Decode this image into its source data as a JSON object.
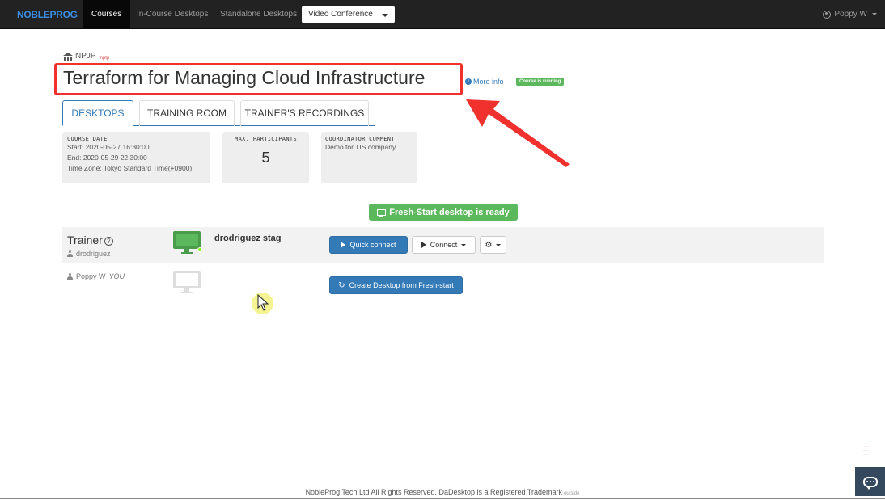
{
  "nav": {
    "brand": "NOBLEPROG",
    "items": [
      {
        "label": "Courses",
        "active": true
      },
      {
        "label": "In-Course Desktops",
        "active": false
      },
      {
        "label": "Standalone Desktops",
        "active": false
      }
    ],
    "select_value": "Video Conference",
    "user": "Poppy W"
  },
  "org": {
    "name": "NPJP",
    "tag": "nptp"
  },
  "course": {
    "title": "Terraform for Managing Cloud Infrastructure",
    "more_info": "More info",
    "status": "Course is running"
  },
  "tabs": [
    {
      "label": "DESKTOPS",
      "active": true
    },
    {
      "label": "TRAINING ROOM",
      "active": false
    },
    {
      "label": "TRAINER'S RECORDINGS",
      "active": false
    }
  ],
  "cards": {
    "course_date": {
      "head": "COURSE DATE",
      "start": "Start: 2020-05-27 16:30:00",
      "end": "End: 2020-05-29 22:30:00",
      "timezone": "Time Zone: Tokyo Standard Time(+0900)"
    },
    "participants": {
      "head": "MAX. PARTICIPANTS",
      "value": "5"
    },
    "comment": {
      "head": "COORDINATOR COMMENT",
      "text": "Demo for TIS company."
    }
  },
  "ready_label": "Fresh-Start desktop is ready",
  "trainer": {
    "role": "Trainer",
    "username": "drodriguez",
    "desktop_name": "drodriguez stag",
    "quick_connect": "Quick connect",
    "connect": "Connect"
  },
  "student": {
    "name": "Poppy W",
    "you": "YOU",
    "create_button": "Create Desktop from Fresh-start"
  },
  "footer": {
    "text": "NobleProg Tech Ltd All Rights Reserved. DaDesktop is a Registered Trademark",
    "tiny": "outside"
  },
  "colors": {
    "accent": "#337ab7",
    "success": "#5cb85c",
    "navbar": "#222222",
    "highlight": "#f0312e"
  }
}
